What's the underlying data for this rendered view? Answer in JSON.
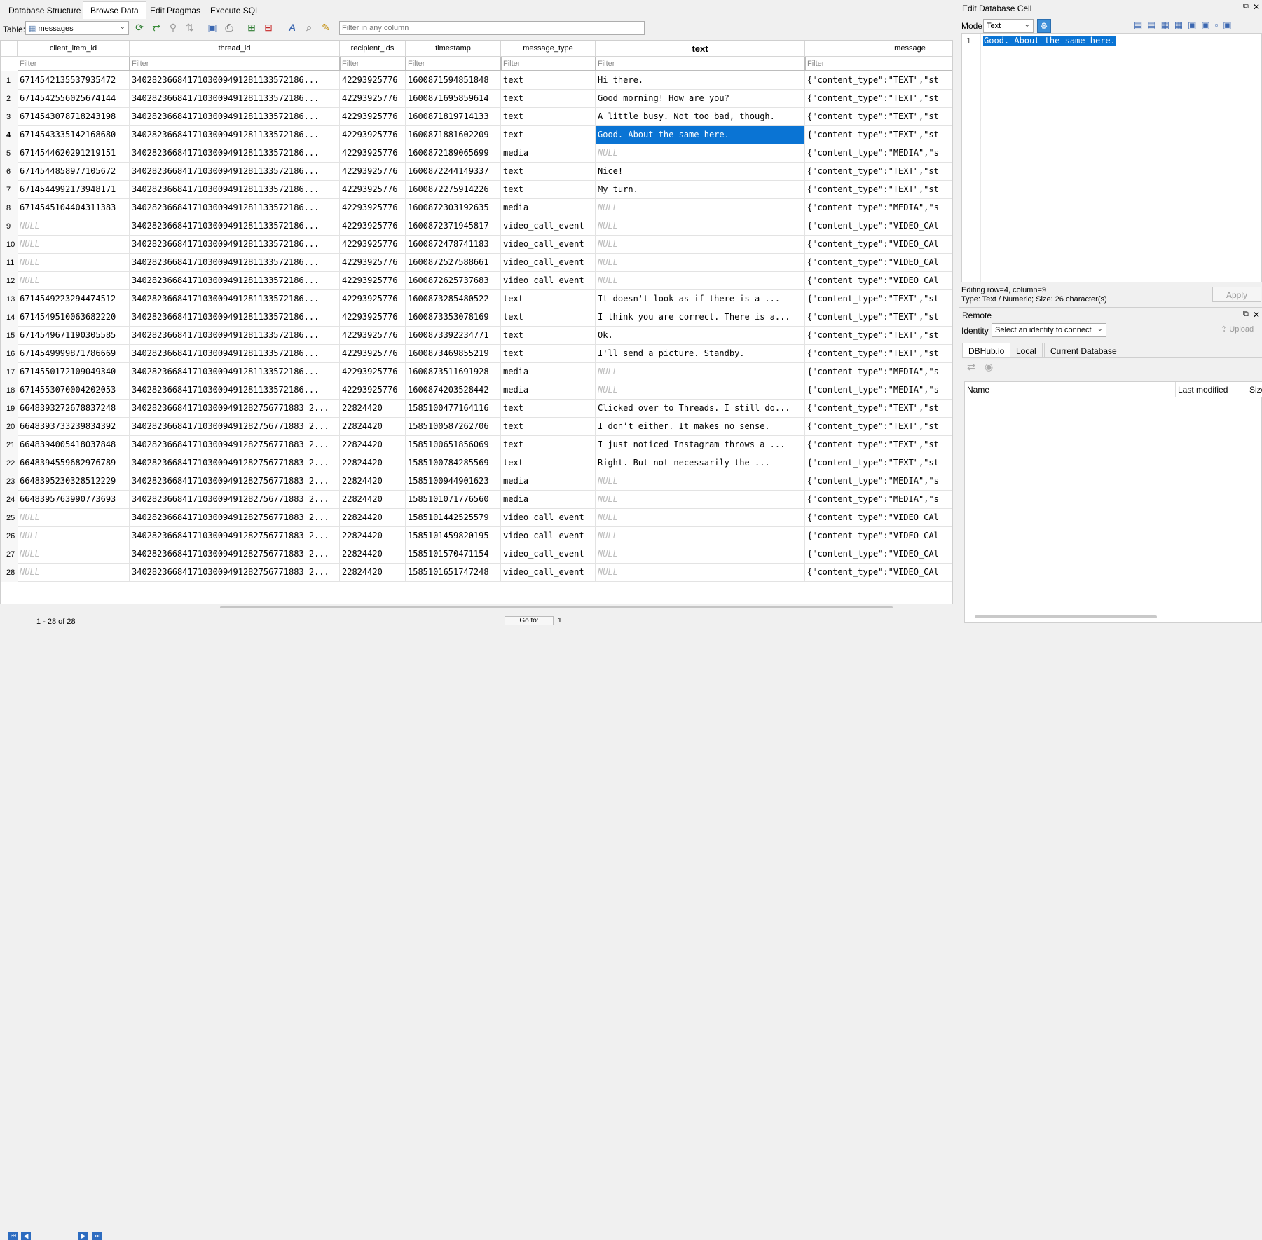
{
  "tabs": [
    "Database Structure",
    "Browse Data",
    "Edit Pragmas",
    "Execute SQL"
  ],
  "toolbar": {
    "table_label": "Table:",
    "table_value": "messages",
    "filter_placeholder": "Filter in any column"
  },
  "grid": {
    "columns": [
      "client_item_id",
      "thread_id",
      "recipient_ids",
      "timestamp",
      "message_type",
      "text",
      "message"
    ],
    "filter_placeholder": "Filter",
    "null_text": "NULL",
    "rows": [
      [
        "6714542135537935472",
        "3402823668417103009491281133572186...",
        "42293925776",
        "1600871594851848",
        "text",
        "Hi there.",
        "{\"content_type\":\"TEXT\",\"st"
      ],
      [
        "6714542556025674144",
        "3402823668417103009491281133572186...",
        "42293925776",
        "1600871695859614",
        "text",
        "Good morning!  How are you?",
        "{\"content_type\":\"TEXT\",\"st"
      ],
      [
        "6714543078718243198",
        "3402823668417103009491281133572186...",
        "42293925776",
        "1600871819714133",
        "text",
        "A little busy. Not too bad, though.",
        "{\"content_type\":\"TEXT\",\"st"
      ],
      [
        "6714543335142168680",
        "3402823668417103009491281133572186...",
        "42293925776",
        "1600871881602209",
        "text",
        "Good. About the same here.",
        "{\"content_type\":\"TEXT\",\"st"
      ],
      [
        "6714544620291219151",
        "3402823668417103009491281133572186...",
        "42293925776",
        "1600872189065699",
        "media",
        "NULL",
        "{\"content_type\":\"MEDIA\",\"s"
      ],
      [
        "6714544858977105672",
        "3402823668417103009491281133572186...",
        "42293925776",
        "1600872244149337",
        "text",
        "Nice!",
        "{\"content_type\":\"TEXT\",\"st"
      ],
      [
        "6714544992173948171",
        "3402823668417103009491281133572186...",
        "42293925776",
        "1600872275914226",
        "text",
        "My turn.",
        "{\"content_type\":\"TEXT\",\"st"
      ],
      [
        "6714545104404311383",
        "3402823668417103009491281133572186...",
        "42293925776",
        "1600872303192635",
        "media",
        "NULL",
        "{\"content_type\":\"MEDIA\",\"s"
      ],
      [
        "NULL",
        "3402823668417103009491281133572186...",
        "42293925776",
        "1600872371945817",
        "video_call_event",
        "NULL",
        "{\"content_type\":\"VIDEO_CAl"
      ],
      [
        "NULL",
        "3402823668417103009491281133572186...",
        "42293925776",
        "1600872478741183",
        "video_call_event",
        "NULL",
        "{\"content_type\":\"VIDEO_CAl"
      ],
      [
        "NULL",
        "3402823668417103009491281133572186...",
        "42293925776",
        "1600872527588661",
        "video_call_event",
        "NULL",
        "{\"content_type\":\"VIDEO_CAl"
      ],
      [
        "NULL",
        "3402823668417103009491281133572186...",
        "42293925776",
        "1600872625737683",
        "video_call_event",
        "NULL",
        "{\"content_type\":\"VIDEO_CAl"
      ],
      [
        "6714549223294474512",
        "3402823668417103009491281133572186...",
        "42293925776",
        "1600873285480522",
        "text",
        "It doesn't look as if there is a ...",
        "{\"content_type\":\"TEXT\",\"st"
      ],
      [
        "6714549510063682220",
        "3402823668417103009491281133572186...",
        "42293925776",
        "1600873353078169",
        "text",
        "I think you are correct. There is a...",
        "{\"content_type\":\"TEXT\",\"st"
      ],
      [
        "6714549671190305585",
        "3402823668417103009491281133572186...",
        "42293925776",
        "1600873392234771",
        "text",
        "Ok.",
        "{\"content_type\":\"TEXT\",\"st"
      ],
      [
        "6714549999871786669",
        "3402823668417103009491281133572186...",
        "42293925776",
        "1600873469855219",
        "text",
        "I'll send a picture. Standby.",
        "{\"content_type\":\"TEXT\",\"st"
      ],
      [
        "6714550172109049340",
        "3402823668417103009491281133572186...",
        "42293925776",
        "1600873511691928",
        "media",
        "NULL",
        "{\"content_type\":\"MEDIA\",\"s"
      ],
      [
        "6714553070004202053",
        "3402823668417103009491281133572186...",
        "42293925776",
        "1600874203528442",
        "media",
        "NULL",
        "{\"content_type\":\"MEDIA\",\"s"
      ],
      [
        "6648393272678837248",
        "3402823668417103009491282756771883 2...",
        "22824420",
        "1585100477164116",
        "text",
        "Clicked over to Threads. I still do...",
        "{\"content_type\":\"TEXT\",\"st"
      ],
      [
        "6648393733239834392",
        "3402823668417103009491282756771883 2...",
        "22824420",
        "1585100587262706",
        "text",
        "I don’t either. It makes no sense.",
        "{\"content_type\":\"TEXT\",\"st"
      ],
      [
        "6648394005418037848",
        "3402823668417103009491282756771883 2...",
        "22824420",
        "1585100651856069",
        "text",
        "I just noticed Instagram throws a ...",
        "{\"content_type\":\"TEXT\",\"st"
      ],
      [
        "6648394559682976789",
        "3402823668417103009491282756771883 2...",
        "22824420",
        "1585100784285569",
        "text",
        "Right.  But not necessarily the ...",
        "{\"content_type\":\"TEXT\",\"st"
      ],
      [
        "6648395230328512229",
        "3402823668417103009491282756771883 2...",
        "22824420",
        "1585100944901623",
        "media",
        "NULL",
        "{\"content_type\":\"MEDIA\",\"s"
      ],
      [
        "6648395763990773693",
        "3402823668417103009491282756771883 2...",
        "22824420",
        "1585101071776560",
        "media",
        "NULL",
        "{\"content_type\":\"MEDIA\",\"s"
      ],
      [
        "NULL",
        "3402823668417103009491282756771883 2...",
        "22824420",
        "1585101442525579",
        "video_call_event",
        "NULL",
        "{\"content_type\":\"VIDEO_CAl"
      ],
      [
        "NULL",
        "3402823668417103009491282756771883 2...",
        "22824420",
        "1585101459820195",
        "video_call_event",
        "NULL",
        "{\"content_type\":\"VIDEO_CAl"
      ],
      [
        "NULL",
        "3402823668417103009491282756771883 2...",
        "22824420",
        "1585101570471154",
        "video_call_event",
        "NULL",
        "{\"content_type\":\"VIDEO_CAl"
      ],
      [
        "NULL",
        "3402823668417103009491282756771883 2...",
        "22824420",
        "1585101651747248",
        "video_call_event",
        "NULL",
        "{\"content_type\":\"VIDEO_CAl"
      ]
    ]
  },
  "edit_cell": {
    "title": "Edit Database Cell",
    "mode_label": "Mode:",
    "mode_value": "Text",
    "line_number": "1",
    "content": "Good. About the same here.",
    "status_line1": "Editing row=4, column=9",
    "status_line2": "Type: Text / Numeric; Size: 26 character(s)",
    "apply_label": "Apply"
  },
  "remote": {
    "title": "Remote",
    "identity_label": "Identity",
    "identity_value": "Select an identity to connect",
    "upload_label": "Upload",
    "tabs": [
      "DBHub.io",
      "Local",
      "Current Database"
    ],
    "columns": [
      "Name",
      "Last modified",
      "Size"
    ]
  },
  "bottom": {
    "record_text": "1 - 28 of 28",
    "goto_label": "Go to:",
    "goto_value": "1"
  }
}
